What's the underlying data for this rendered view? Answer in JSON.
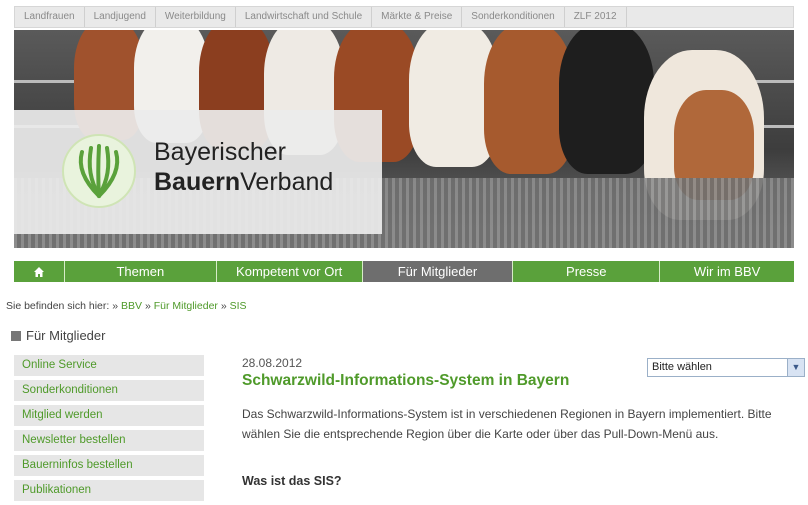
{
  "top_tabs": [
    "Landfrauen",
    "Landjugend",
    "Weiterbildung",
    "Landwirtschaft und Schule",
    "Märkte & Preise",
    "Sonderkonditionen",
    "ZLF 2012"
  ],
  "brand": {
    "line1": "Bayerischer",
    "line2_bold": "Bauern",
    "line2_rest": "Verband"
  },
  "main_nav": {
    "home_icon": "home-icon",
    "items": [
      "Themen",
      "Kompetent vor Ort",
      "Für Mitglieder",
      "Presse",
      "Wir im BBV"
    ],
    "active": "Für Mitglieder"
  },
  "breadcrumb": {
    "prefix": "Sie befinden sich hier:",
    "sep": "»",
    "links": [
      "BBV",
      "Für Mitglieder",
      "SIS"
    ]
  },
  "section_title": "Für Mitglieder",
  "sidebar": [
    "Online Service",
    "Sonderkonditionen",
    "Mitglied werden",
    "Newsletter bestellen",
    "Bauerninfos bestellen",
    "Publikationen"
  ],
  "article": {
    "date": "28.08.2012",
    "title": "Schwarzwild-Informations-System in Bayern",
    "select_value": "Bitte wählen",
    "paragraph": "Das Schwarzwild-Informations-System ist in verschiedenen Regionen in Bayern implementiert. Bitte wählen Sie die entsprechende Region über die Karte oder über das Pull-Down-Menü aus.",
    "subheading": "Was ist das SIS?"
  },
  "colors": {
    "green": "#5aa13b",
    "link_green": "#4f9a2a",
    "nav_active": "#6e6e6e"
  }
}
